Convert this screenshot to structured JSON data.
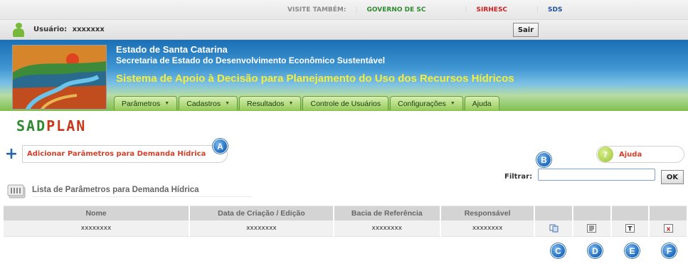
{
  "topbar": {
    "visite_label": "VISITE TAMBÉM:",
    "links": [
      "GOVERNO DE SC",
      "SIRHESC",
      "SDS"
    ]
  },
  "userbar": {
    "user_label": "Usuário:",
    "user_value": "xxxxxxx",
    "logout_label": "Sair"
  },
  "banner": {
    "title": "Estado de Santa Catarina",
    "subtitle": "Secretaria de Estado do Desenvolvimento Econômico Sustentável",
    "system_name": "Sistema de Apoio à Decisão para Planejamento do Uso dos Recursos Hídricos"
  },
  "menu": [
    {
      "label": "Parâmetros",
      "dropdown": true
    },
    {
      "label": "Cadastros",
      "dropdown": true
    },
    {
      "label": "Resultados",
      "dropdown": true
    },
    {
      "label": "Controle de Usuários",
      "dropdown": false
    },
    {
      "label": "Configurações",
      "dropdown": true
    },
    {
      "label": "Ajuda",
      "dropdown": false
    }
  ],
  "brand": {
    "part1": "SAD",
    "part2": "PLAN"
  },
  "add_parameter_label": "Adicionar Parâmetros para Demanda Hídrica",
  "help_label": "Ajuda",
  "filter": {
    "label": "Filtrar:",
    "value": "",
    "button": "OK"
  },
  "list_title": "Lista de Parâmetros para Demanda Hídrica",
  "table": {
    "columns": [
      "Nome",
      "Data de Criação / Edição",
      "Bacia de Referência",
      "Responsável"
    ],
    "rows": [
      [
        "xxxxxxxx",
        "xxxxxxxx",
        "xxxxxxxx",
        "xxxxxxxx"
      ]
    ]
  },
  "markers": [
    "A",
    "B",
    "C",
    "D",
    "E",
    "F"
  ],
  "colors": {
    "accent_blue": "#1d6bbf",
    "brand_green": "#2e8a2e",
    "brand_red": "#c6391a",
    "menu_green": "#97cb5a",
    "banner_yellow": "#f5ef3a"
  },
  "icons": {
    "copy": "copy-icon",
    "view": "view-details-icon",
    "text": "text-icon",
    "delete": "delete-icon"
  }
}
